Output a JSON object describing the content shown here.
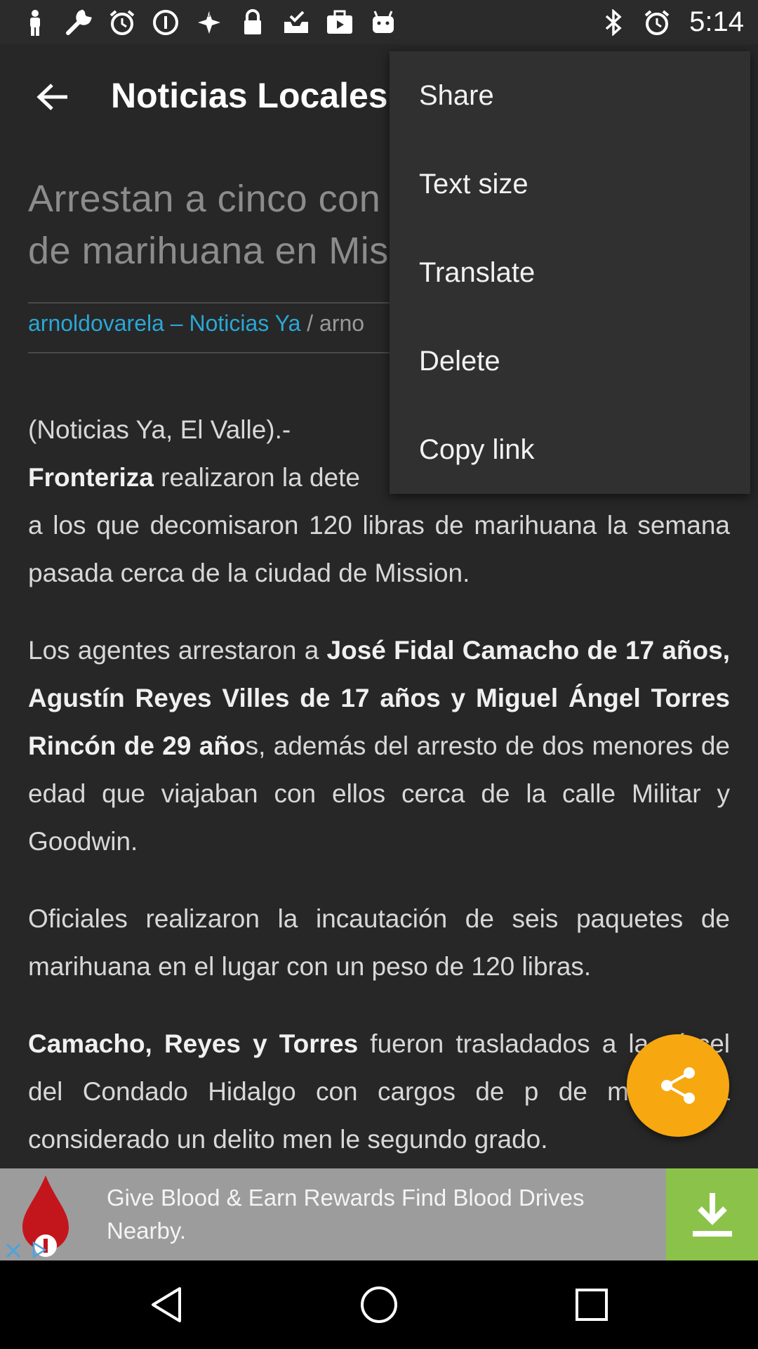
{
  "status_bar": {
    "time": "5:14",
    "left_icons": [
      "person-icon",
      "wrench-icon",
      "alarm-icon",
      "info-icon",
      "fake-gps-icon",
      "lock-icon",
      "inbox-icon",
      "briefcase-icon",
      "android-icon"
    ],
    "right_icons": [
      "bluetooth-icon",
      "alarm-icon"
    ]
  },
  "toolbar": {
    "title": "Noticias Locales"
  },
  "article": {
    "title": "Arrestan a cinco con paquetes de marihuana en Mission",
    "title_visible_line1": "Arrestan a cinco con pa",
    "title_visible_line2": "de marihuana en Missi",
    "byline_author": "arnoldovarela – Noticias Ya",
    "byline_rest": " / arno",
    "p1_a": "(Noticias Ya, El Valle).- ",
    "p1_bold": "Fronteriza",
    "p1_b": " realizaron la dete",
    "p1_c": "a los que decomisaron 120 libras de marihuana la semana pasada cerca de la ciudad de Mission.",
    "p2_a": "Los agentes arrestaron a ",
    "p2_bold": "José Fidal Camacho de 17 años, Agustín Reyes Villes de 17 años y Miguel Ángel Torres Rincón de 29 año",
    "p2_b": "s, además del arresto de dos menores de edad que viajaban con ellos cerca de la calle Militar y Goodwin.",
    "p3": "Oficiales realizaron la incautación de seis paquetes de marihuana en el lugar con un peso de 120 libras.",
    "p4_bold": "Camacho, Reyes y Torres",
    "p4_rest": " fueron trasladados a la cárcel del Condado Hidalgo con cargos de p de marihuana considerado un delito men le segundo grado."
  },
  "menu": {
    "items": [
      {
        "label": "Share"
      },
      {
        "label": "Text size"
      },
      {
        "label": "Translate"
      },
      {
        "label": "Delete"
      },
      {
        "label": "Copy link"
      }
    ]
  },
  "fab": {
    "icon": "share-icon",
    "color": "#f7a70f"
  },
  "ad": {
    "text": "Give Blood & Earn Rewards Find Blood Drives Nearby.",
    "download_color": "#8bc34a"
  },
  "colors": {
    "accent_link": "#2aa7d6",
    "background": "#272727"
  }
}
